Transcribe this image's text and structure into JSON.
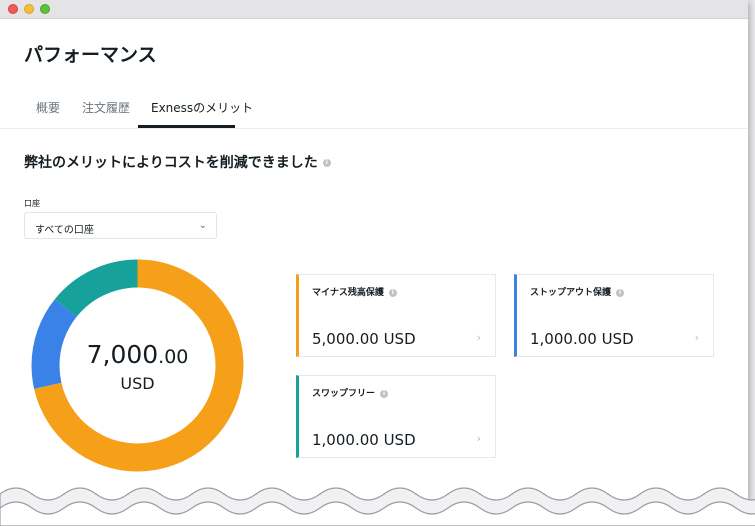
{
  "page": {
    "title": "パフォーマンス"
  },
  "tabs": [
    {
      "label": "概要",
      "active": false
    },
    {
      "label": "注文履歴",
      "active": false
    },
    {
      "label": "Exnessのメリット",
      "active": true
    }
  ],
  "section": {
    "heading": "弊社のメリットによりコストを削減できました"
  },
  "account_select": {
    "label": "口座",
    "value": "すべての口座"
  },
  "total": {
    "amount_whole": "7,000",
    "amount_cents": ".00",
    "currency": "USD"
  },
  "cards": [
    {
      "title": "マイナス残高保護",
      "value": "5,000.00 USD",
      "color": "#f6a01a"
    },
    {
      "title": "ストップアウト保護",
      "value": "1,000.00 USD",
      "color": "#3b82e8"
    },
    {
      "title": "スワップフリー",
      "value": "1,000.00 USD",
      "color": "#16a19a"
    }
  ],
  "chart_data": {
    "type": "pie",
    "categories": [
      "マイナス残高保護",
      "ストップアウト保護",
      "スワップフリー"
    ],
    "values": [
      5000,
      1000,
      1000
    ],
    "colors": [
      "#f6a01a",
      "#3b82e8",
      "#16a19a"
    ]
  },
  "colors": {
    "accent": "#141d22",
    "muted": "#6c757b"
  }
}
